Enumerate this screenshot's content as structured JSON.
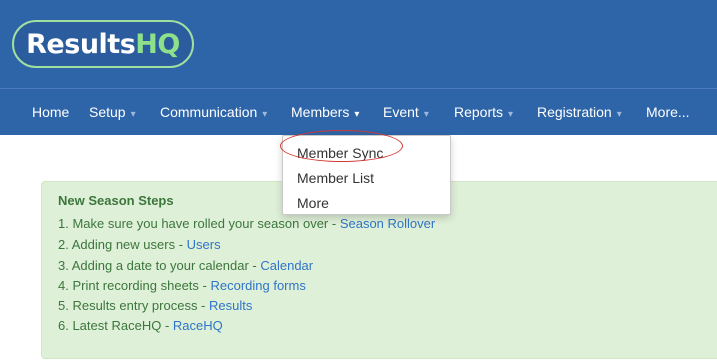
{
  "brand": {
    "logo_main": "Results",
    "logo_accent": "HQ"
  },
  "nav": {
    "items": [
      {
        "label": "Home",
        "caret": ""
      },
      {
        "label": "Setup",
        "caret": "▾"
      },
      {
        "label": "Communication",
        "caret": "▾"
      },
      {
        "label": "Members",
        "caret": "▾"
      },
      {
        "label": "Event",
        "caret": "▾"
      },
      {
        "label": "Reports",
        "caret": "▾"
      },
      {
        "label": "Registration",
        "caret": "▾"
      },
      {
        "label": "More...",
        "caret": ""
      }
    ]
  },
  "members_menu": {
    "items": [
      {
        "label": "Member Sync"
      },
      {
        "label": "Member List"
      },
      {
        "label": "More"
      }
    ]
  },
  "steps": {
    "title": "New Season Steps",
    "items": [
      {
        "text": "1. Make sure you have rolled your season over - ",
        "link": "Season Rollover"
      },
      {
        "text": "2. Adding new users - ",
        "link": "Users"
      },
      {
        "text": "3. Adding a date to your calendar - ",
        "link": "Calendar"
      },
      {
        "text": "4. Print recording sheets - ",
        "link": "Recording forms"
      },
      {
        "text": "5. Results entry process - ",
        "link": "Results"
      },
      {
        "text": "6. Latest RaceHQ - ",
        "link": "RaceHQ"
      }
    ]
  },
  "colors": {
    "header": "#2e64a8",
    "panel": "#dff0d8",
    "panel_text": "#3c763d",
    "link": "#2f75c8",
    "highlight": "#d23a32"
  }
}
